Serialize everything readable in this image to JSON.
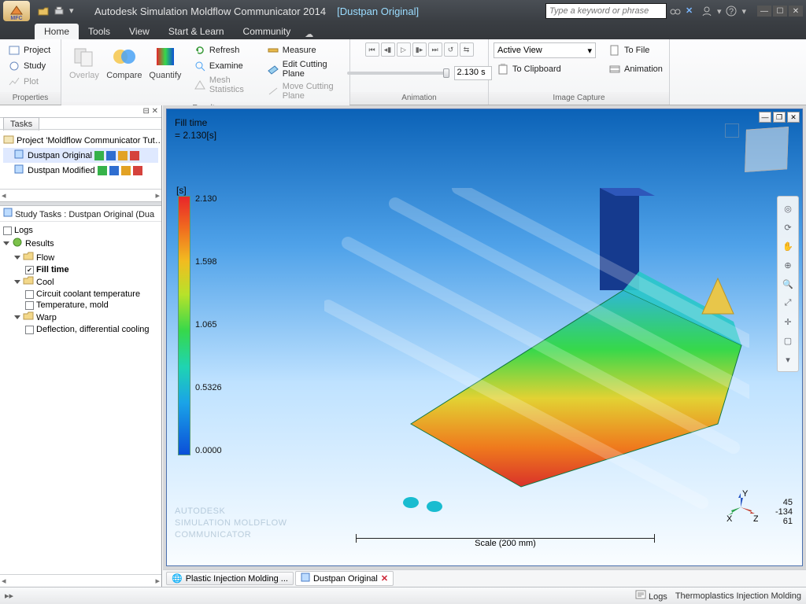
{
  "app": {
    "title": "Autodesk Simulation Moldflow Communicator 2014",
    "document": "[Dustpan Original]",
    "search_placeholder": "Type a keyword or phrase"
  },
  "tabs": [
    "Home",
    "Tools",
    "View",
    "Start & Learn",
    "Community"
  ],
  "active_tab": 0,
  "ribbon": {
    "properties": {
      "label": "Properties",
      "project": "Project",
      "study": "Study",
      "plot": "Plot"
    },
    "results": {
      "label": "Results",
      "overlay": "Overlay",
      "compare": "Compare",
      "quantify": "Quantify",
      "refresh": "Refresh",
      "examine": "Examine",
      "mesh": "Mesh Statistics",
      "measure": "Measure",
      "cutplane": "Edit Cutting Plane",
      "movecut": "Move Cutting Plane"
    },
    "animation": {
      "label": "Animation",
      "time": "2.130 s"
    },
    "capture": {
      "label": "Image Capture",
      "active_view": "Active View",
      "tofile": "To File",
      "toclip": "To Clipboard",
      "animation": "Animation"
    }
  },
  "sidebar": {
    "tasks_tab": "Tasks",
    "project_row": "Project 'Moldflow Communicator Tut…",
    "studies": [
      {
        "name": "Dustpan Original",
        "selected": true
      },
      {
        "name": "Dustpan Modified",
        "selected": false
      }
    ],
    "study_header": "Study Tasks : Dustpan Original (Dua",
    "tree": {
      "logs": "Logs",
      "results": "Results",
      "flow": "Flow",
      "fill_time": "Fill time",
      "cool": "Cool",
      "cool_items": [
        "Circuit coolant temperature",
        "Temperature, mold"
      ],
      "warp": "Warp",
      "warp_items": [
        "Deflection, differential cooling"
      ]
    }
  },
  "viewport": {
    "plot_title": "Fill time",
    "plot_value": "= 2.130[s]",
    "legend_unit": "[s]",
    "legend_values": [
      "2.130",
      "1.598",
      "1.065",
      "0.5326",
      "0.0000"
    ],
    "scale_label": "Scale (200 mm)",
    "coords": {
      "x": "45",
      "y": "-134",
      "z": "61"
    },
    "watermark1": "AUTODESK",
    "watermark2": "SIMULATION MOLDFLOW",
    "watermark3": "COMMUNICATOR",
    "doc_tabs": [
      "Plastic Injection Molding ...",
      "Dustpan Original"
    ]
  },
  "statusbar": {
    "logs": "Logs",
    "process": "Thermoplastics Injection Molding"
  },
  "chart_data": {
    "type": "colormap_legend",
    "title": "Fill time",
    "unit": "s",
    "min": 0.0,
    "max": 2.13,
    "ticks": [
      2.13,
      1.598,
      1.065,
      0.5326,
      0.0
    ],
    "colormap": "rainbow (red=high → blue=low)",
    "current_time_s": 2.13,
    "scale_bar_mm": 200,
    "view_angles_deg": {
      "a": 45,
      "b": -134,
      "c": 61
    }
  }
}
